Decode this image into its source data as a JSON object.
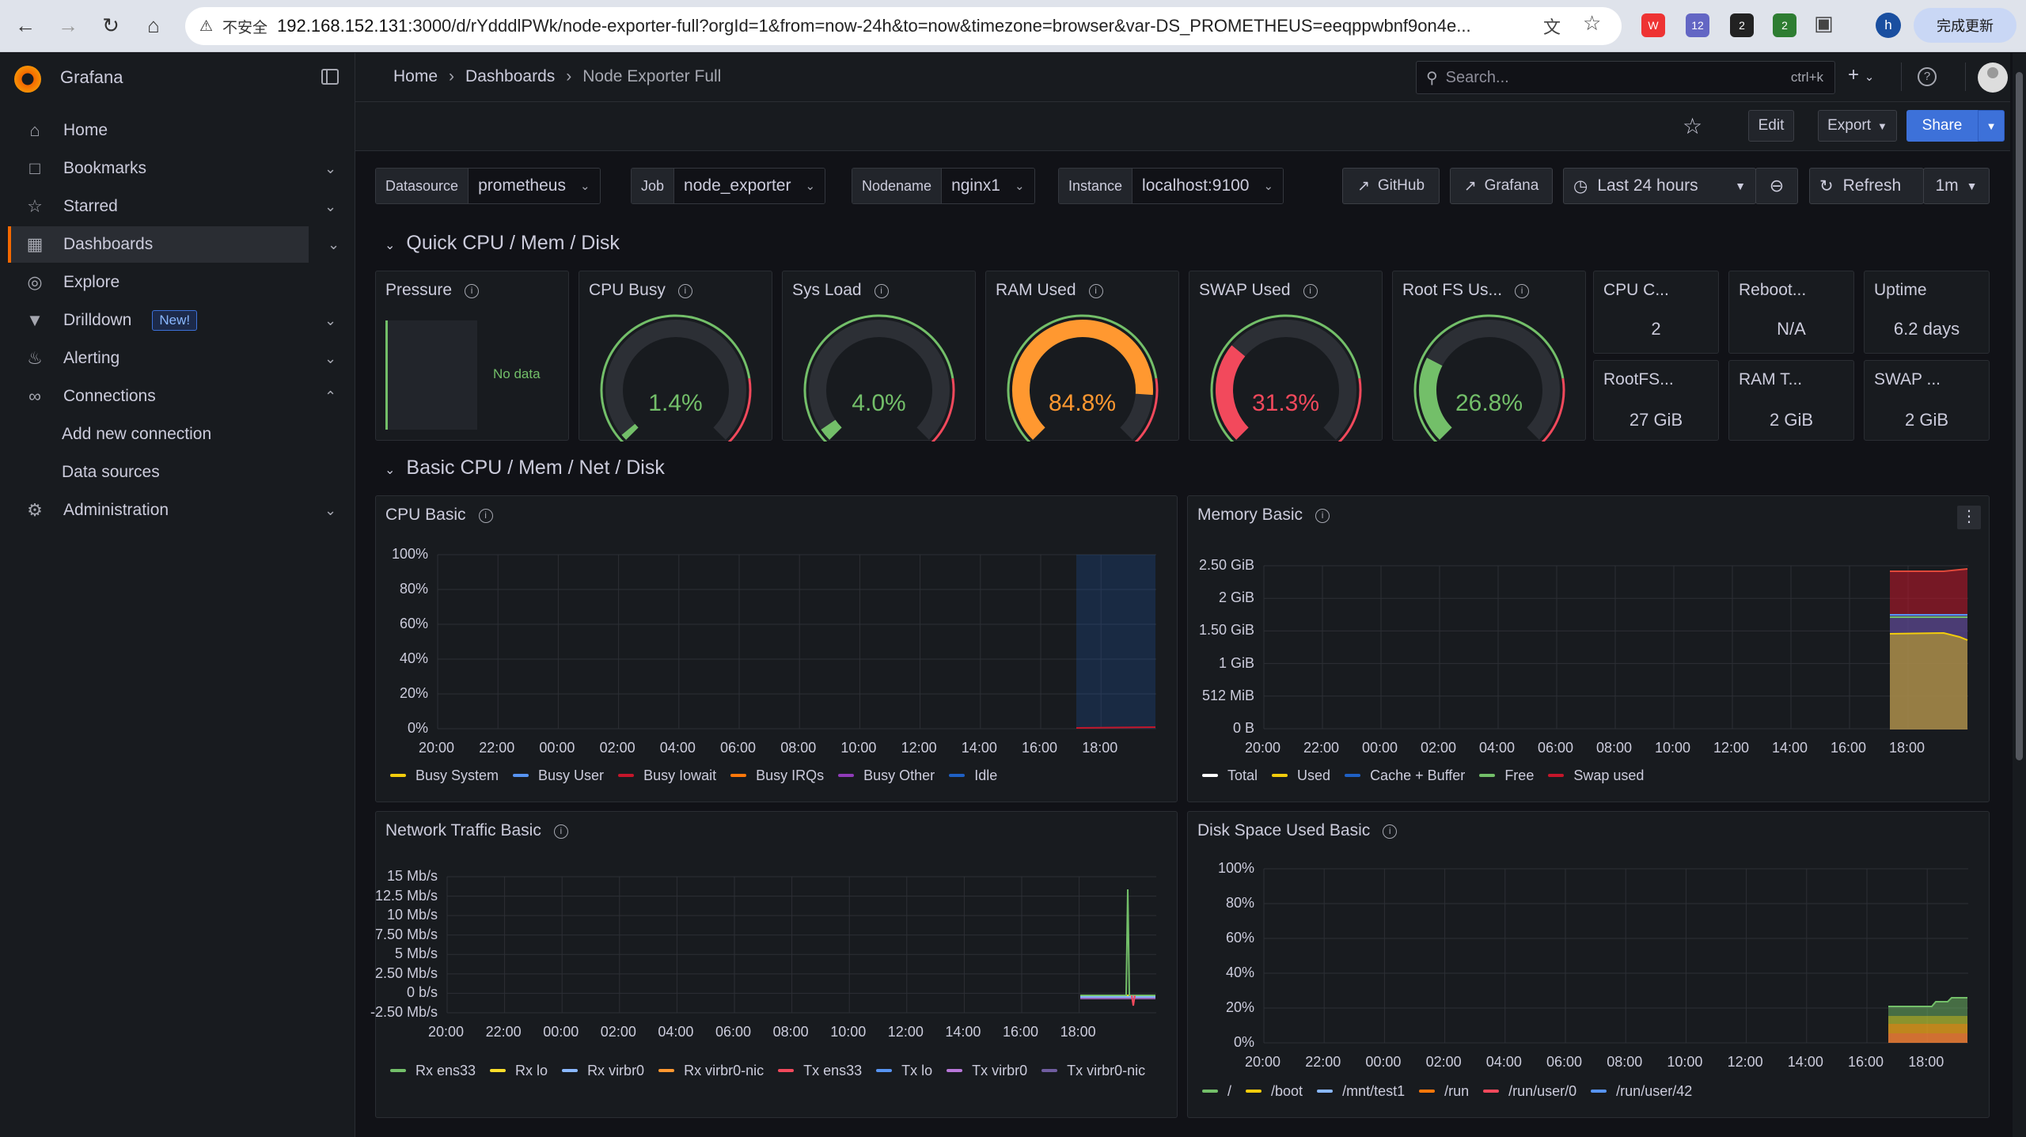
{
  "browser": {
    "url_warning": "不安全",
    "url_host": "192.168.152.131",
    "url_rest": ":3000/d/rYdddlPWk/node-exporter-full?orgId=1&from=now-24h&to=now&timezone=browser&var-DS_PROMETHEUS=eeqppwbnf9on4e...",
    "update_label": "完成更新",
    "profile_initial": "h",
    "ext_badges": [
      "12",
      "2",
      "2"
    ]
  },
  "sidebar": {
    "app_name": "Grafana",
    "items": [
      {
        "label": "Home",
        "icon": "home-icon"
      },
      {
        "label": "Bookmarks",
        "icon": "bookmark-icon"
      },
      {
        "label": "Starred",
        "icon": "star-icon"
      },
      {
        "label": "Dashboards",
        "icon": "dashboards-icon"
      },
      {
        "label": "Explore",
        "icon": "compass-icon"
      },
      {
        "label": "Drilldown",
        "icon": "drilldown-icon",
        "badge": "New!"
      },
      {
        "label": "Alerting",
        "icon": "bell-icon"
      },
      {
        "label": "Connections",
        "icon": "connections-icon"
      },
      {
        "label": "Administration",
        "icon": "gear-icon"
      }
    ],
    "subitems": [
      "Add new connection",
      "Data sources"
    ]
  },
  "breadcrumb": [
    "Home",
    "Dashboards",
    "Node Exporter Full"
  ],
  "search": {
    "placeholder": "Search...",
    "shortcut": "ctrl+k"
  },
  "toolbar": {
    "edit": "Edit",
    "export": "Export",
    "share": "Share"
  },
  "variables": [
    {
      "key": "Datasource",
      "value": "prometheus"
    },
    {
      "key": "Job",
      "value": "node_exporter"
    },
    {
      "key": "Nodename",
      "value": "nginx1"
    },
    {
      "key": "Instance",
      "value": "localhost:9100"
    }
  ],
  "links": {
    "github": "GitHub",
    "grafana": "Grafana"
  },
  "time": {
    "range": "Last 24 hours",
    "refresh": "Refresh",
    "interval": "1m"
  },
  "rows": {
    "quick": "Quick CPU / Mem / Disk",
    "basic": "Basic CPU / Mem / Net / Disk"
  },
  "quick": {
    "pressure": {
      "title": "Pressure",
      "nodata": "No data"
    },
    "gauges": [
      {
        "title": "CPU Busy",
        "value": "1.4%",
        "fraction": 0.014,
        "color": "#73bf69"
      },
      {
        "title": "Sys Load",
        "value": "4.0%",
        "fraction": 0.04,
        "color": "#73bf69"
      },
      {
        "title": "RAM Used",
        "value": "84.8%",
        "fraction": 0.848,
        "color": "#ff9830"
      },
      {
        "title": "SWAP Used",
        "value": "31.3%",
        "fraction": 0.313,
        "color": "#f2495c"
      },
      {
        "title": "Root FS Us...",
        "value": "26.8%",
        "fraction": 0.268,
        "color": "#73bf69"
      }
    ],
    "stats": [
      {
        "title": "CPU C...",
        "value": "2"
      },
      {
        "title": "Reboot...",
        "value": "N/A"
      },
      {
        "title": "Uptime",
        "value": "6.2 days"
      },
      {
        "title": "RootFS...",
        "value": "27 GiB"
      },
      {
        "title": "RAM T...",
        "value": "2 GiB"
      },
      {
        "title": "SWAP ...",
        "value": "2 GiB"
      }
    ]
  },
  "chart_data": [
    {
      "type": "line",
      "title": "CPU Basic",
      "x": [
        "20:00",
        "22:00",
        "00:00",
        "02:00",
        "04:00",
        "06:00",
        "08:00",
        "10:00",
        "12:00",
        "14:00",
        "16:00",
        "18:00"
      ],
      "y_ticks": [
        "100%",
        "80%",
        "60%",
        "40%",
        "20%",
        "0%"
      ],
      "ylim": [
        0,
        100
      ],
      "series": [
        {
          "name": "Busy System",
          "color": "#f2cc0c",
          "values": [
            1.5
          ]
        },
        {
          "name": "Busy User",
          "color": "#5794f2",
          "values": [
            1.2
          ]
        },
        {
          "name": "Busy Iowait",
          "color": "#c4162a",
          "values": [
            0.3
          ]
        },
        {
          "name": "Busy IRQs",
          "color": "#ff780a",
          "values": [
            0.1
          ]
        },
        {
          "name": "Busy Other",
          "color": "#8f3bb8",
          "values": [
            0.1
          ]
        },
        {
          "name": "Idle",
          "color": "#1f60c4",
          "values": [
            97
          ]
        }
      ]
    },
    {
      "type": "area",
      "title": "Memory Basic",
      "x": [
        "20:00",
        "22:00",
        "00:00",
        "02:00",
        "04:00",
        "06:00",
        "08:00",
        "10:00",
        "12:00",
        "14:00",
        "16:00",
        "18:00"
      ],
      "y_ticks": [
        "2.50 GiB",
        "2 GiB",
        "1.50 GiB",
        "1 GiB",
        "512 MiB",
        "0 B"
      ],
      "series": [
        {
          "name": "Total",
          "color": "#ffffff"
        },
        {
          "name": "Used",
          "color": "#f2cc0c"
        },
        {
          "name": "Cache + Buffer",
          "color": "#1f60c4"
        },
        {
          "name": "Free",
          "color": "#73bf69"
        },
        {
          "name": "Swap used",
          "color": "#c4162a"
        }
      ]
    },
    {
      "type": "line",
      "title": "Network Traffic Basic",
      "x": [
        "20:00",
        "22:00",
        "00:00",
        "02:00",
        "04:00",
        "06:00",
        "08:00",
        "10:00",
        "12:00",
        "14:00",
        "16:00",
        "18:00"
      ],
      "y_ticks": [
        "15 Mb/s",
        "12.5 Mb/s",
        "10 Mb/s",
        "7.50 Mb/s",
        "5 Mb/s",
        "2.50 Mb/s",
        "0 b/s",
        "-2.50 Mb/s"
      ],
      "series": [
        {
          "name": "Rx ens33",
          "color": "#73bf69"
        },
        {
          "name": "Rx lo",
          "color": "#fade2a"
        },
        {
          "name": "Rx virbr0",
          "color": "#8ab8ff"
        },
        {
          "name": "Rx virbr0-nic",
          "color": "#ff9830"
        },
        {
          "name": "Tx ens33",
          "color": "#f2495c"
        },
        {
          "name": "Tx lo",
          "color": "#5794f2"
        },
        {
          "name": "Tx virbr0",
          "color": "#b877d9"
        },
        {
          "name": "Tx virbr0-nic",
          "color": "#705da0"
        }
      ]
    },
    {
      "type": "area",
      "title": "Disk Space Used Basic",
      "x": [
        "20:00",
        "22:00",
        "00:00",
        "02:00",
        "04:00",
        "06:00",
        "08:00",
        "10:00",
        "12:00",
        "14:00",
        "16:00",
        "18:00"
      ],
      "y_ticks": [
        "100%",
        "80%",
        "60%",
        "40%",
        "20%",
        "0%"
      ],
      "series": [
        {
          "name": "/",
          "color": "#73bf69"
        },
        {
          "name": "/boot",
          "color": "#f2cc0c"
        },
        {
          "name": "/mnt/test1",
          "color": "#8ab8ff"
        },
        {
          "name": "/run",
          "color": "#ff780a"
        },
        {
          "name": "/run/user/0",
          "color": "#f2495c"
        },
        {
          "name": "/run/user/42",
          "color": "#5794f2"
        }
      ]
    }
  ]
}
